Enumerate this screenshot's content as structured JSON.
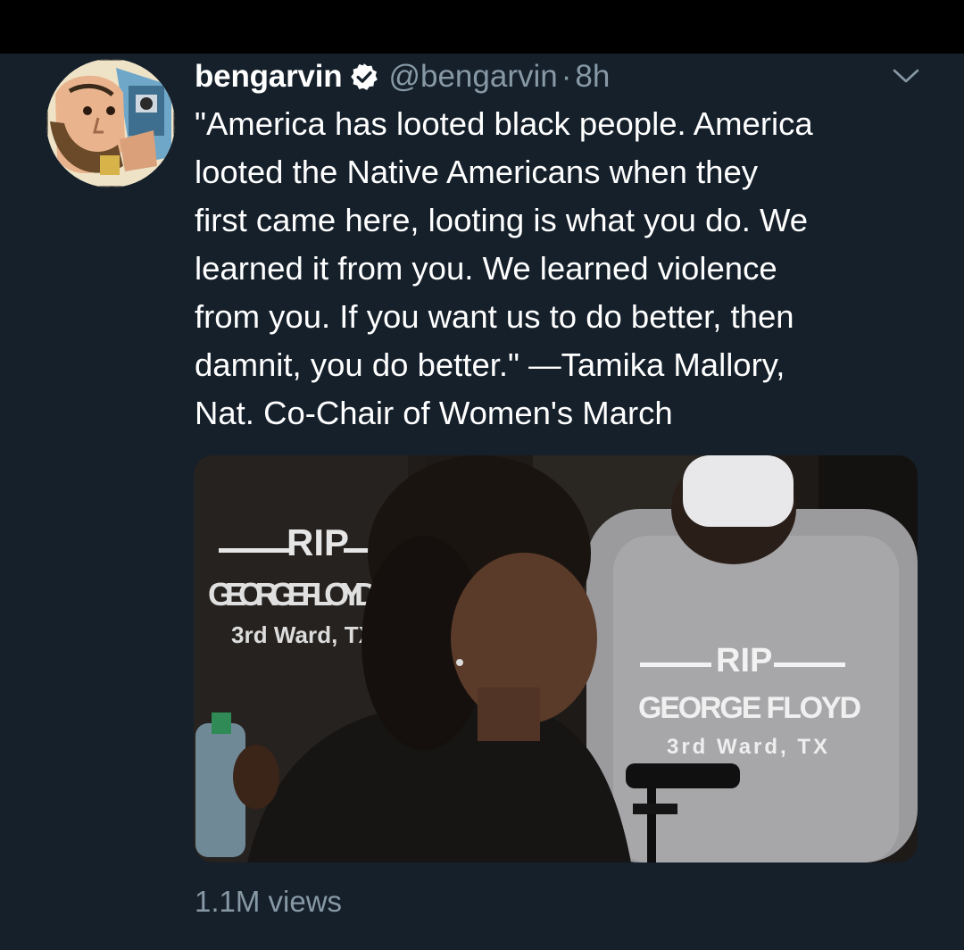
{
  "tweet": {
    "display_name": "bengarvin",
    "handle": "@bengarvin",
    "separator": "·",
    "time": "8h",
    "text": "\"America has looted black people. America\nlooted the Native Americans when they\nfirst came here, looting is what you do. We\nlearned it from you. We learned violence\nfrom you. If you want us to do better, then\ndamnit, you do better.\" —Tamika Mallory,\nNat. Co-Chair of Women's March",
    "views": "1.1M views"
  },
  "media": {
    "shirt_left": {
      "line1": "RIP",
      "line2": "GEORGE FLOYD",
      "line3": "3rd Ward, TX"
    },
    "shirt_right": {
      "line1": "RIP",
      "line2": "GEORGE FLOYD",
      "line3": "3rd Ward, TX"
    }
  },
  "icons": {
    "verified": "verified-badge-icon",
    "caret": "chevron-down-icon"
  },
  "colors": {
    "background": "#15202b",
    "text_primary": "#ffffff",
    "text_secondary": "#8899a6"
  }
}
